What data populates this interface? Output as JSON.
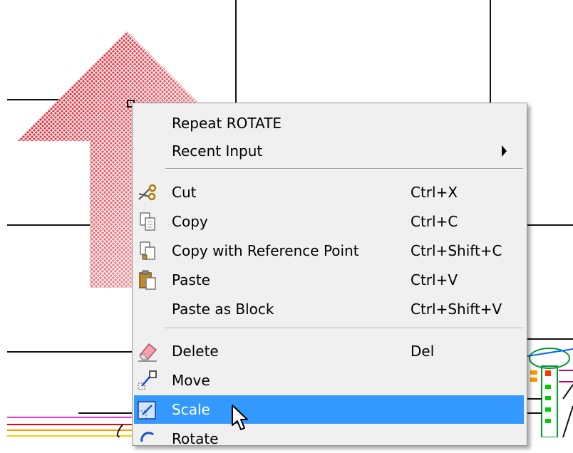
{
  "menu": {
    "items": [
      {
        "label": "Repeat ROTATE",
        "shortcut": "",
        "icon": "",
        "submenu": false
      },
      {
        "label": "Recent Input",
        "shortcut": "",
        "icon": "",
        "submenu": true
      },
      {
        "label": "Cut",
        "shortcut": "Ctrl+X",
        "icon": "scissors-icon",
        "submenu": false
      },
      {
        "label": "Copy",
        "shortcut": "Ctrl+C",
        "icon": "copy-icon",
        "submenu": false
      },
      {
        "label": "Copy with Reference Point",
        "shortcut": "Ctrl+Shift+C",
        "icon": "copy-base-point-icon",
        "submenu": false
      },
      {
        "label": "Paste",
        "shortcut": "Ctrl+V",
        "icon": "paste-icon",
        "submenu": false
      },
      {
        "label": "Paste as Block",
        "shortcut": "Ctrl+Shift+V",
        "icon": "",
        "submenu": false
      },
      {
        "label": "Delete",
        "shortcut": "Del",
        "icon": "eraser-icon",
        "submenu": false
      },
      {
        "label": "Move",
        "shortcut": "",
        "icon": "move-icon",
        "submenu": false
      },
      {
        "label": "Scale",
        "shortcut": "",
        "icon": "scale-icon",
        "submenu": false,
        "highlighted": true
      },
      {
        "label": "Rotate",
        "shortcut": "",
        "icon": "rotate-icon",
        "submenu": false
      }
    ]
  },
  "colors": {
    "menu_bg": "#f0f0f0",
    "highlight": "#3399ff",
    "hatch_red": "#e0202a"
  }
}
